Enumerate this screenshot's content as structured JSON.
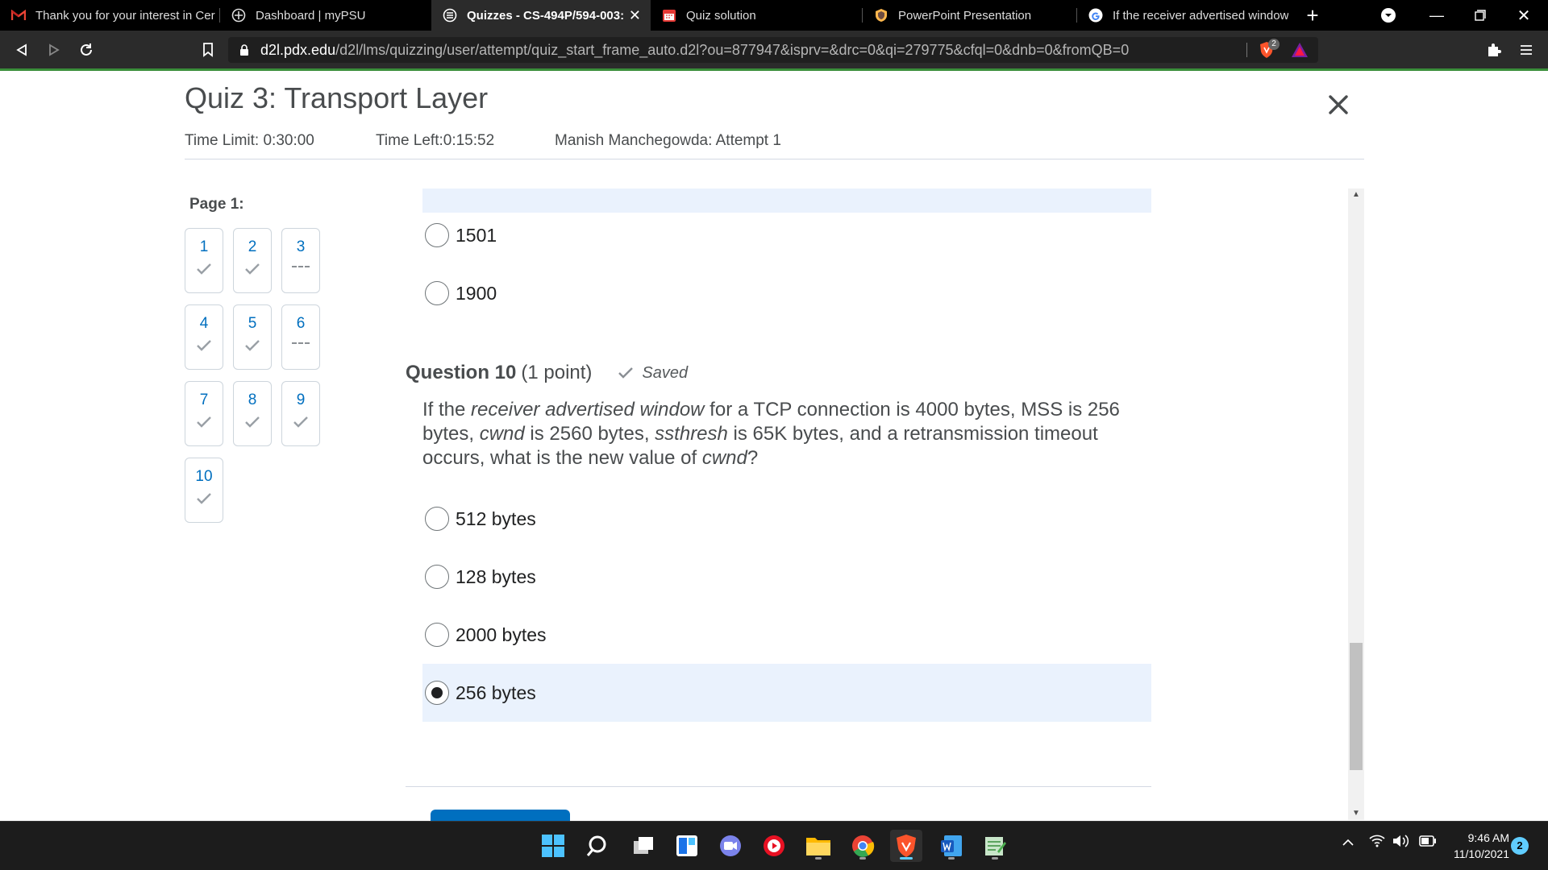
{
  "browser": {
    "tabs": [
      {
        "title": "Thank you for your interest in Cer",
        "icon": "gmail-icon"
      },
      {
        "title": "Dashboard | myPSU",
        "icon": "psu-icon"
      },
      {
        "title": "Quizzes - CS-494P/594-003:",
        "icon": "d2l-icon",
        "active": true
      },
      {
        "title": "Quiz solution",
        "icon": "calendar-icon"
      },
      {
        "title": "PowerPoint Presentation",
        "icon": "shield-icon"
      },
      {
        "title": "If the receiver advertised window",
        "icon": "google-icon"
      }
    ],
    "url_host": "d2l.pdx.edu",
    "url_path": "/d2l/lms/quizzing/user/attempt/quiz_start_frame_auto.d2l?ou=877947&isprv=&drc=0&qi=279775&cfql=0&dnb=0&fromQB=0",
    "shields_count": "2"
  },
  "quiz": {
    "title": "Quiz 3: Transport Layer",
    "time_limit": "Time Limit: 0:30:00",
    "time_left": "Time Left:0:15:52",
    "attempt": "Manish Manchegowda: Attempt 1"
  },
  "sidebar": {
    "page_label": "Page 1:",
    "questions": [
      {
        "num": "1",
        "status": "answered"
      },
      {
        "num": "2",
        "status": "answered"
      },
      {
        "num": "3",
        "status": "unanswered"
      },
      {
        "num": "4",
        "status": "answered"
      },
      {
        "num": "5",
        "status": "answered"
      },
      {
        "num": "6",
        "status": "unanswered"
      },
      {
        "num": "7",
        "status": "answered"
      },
      {
        "num": "8",
        "status": "answered"
      },
      {
        "num": "9",
        "status": "answered"
      },
      {
        "num": "10",
        "status": "answered"
      }
    ]
  },
  "prev_question": {
    "options": [
      "1501",
      "1900"
    ]
  },
  "question10": {
    "number": "Question 10",
    "points": "(1 point)",
    "saved": "Saved",
    "text_parts": [
      {
        "t": "If the ",
        "i": false
      },
      {
        "t": "receiver advertised window",
        "i": true
      },
      {
        "t": " for a TCP connection is 4000 bytes, MSS is 256 bytes, ",
        "i": false
      },
      {
        "t": "cwnd",
        "i": true
      },
      {
        "t": " is 2560 bytes, ",
        "i": false
      },
      {
        "t": "ssthresh",
        "i": true
      },
      {
        "t": " is 65K bytes, and a retransmission timeout occurs, what is the new value of ",
        "i": false
      },
      {
        "t": "cwnd",
        "i": true
      },
      {
        "t": "?",
        "i": false
      }
    ],
    "options": [
      "512 bytes",
      "128 bytes",
      "2000 bytes",
      "256 bytes"
    ],
    "selected_index": 3
  },
  "taskbar": {
    "apps": [
      "windows-start-icon",
      "search-icon",
      "task-view-icon",
      "widgets-icon",
      "teams-chat-icon",
      "media-player-icon",
      "file-explorer-icon",
      "chrome-icon",
      "brave-icon",
      "word-icon",
      "notepad-icon"
    ],
    "time": "9:46 AM",
    "date": "11/10/2021",
    "notifications": "2"
  },
  "colors": {
    "accent": "#006fbf",
    "selected_bg": "#eaf2fd",
    "text": "#494c4e",
    "green_bar": "#3a8e3a"
  }
}
